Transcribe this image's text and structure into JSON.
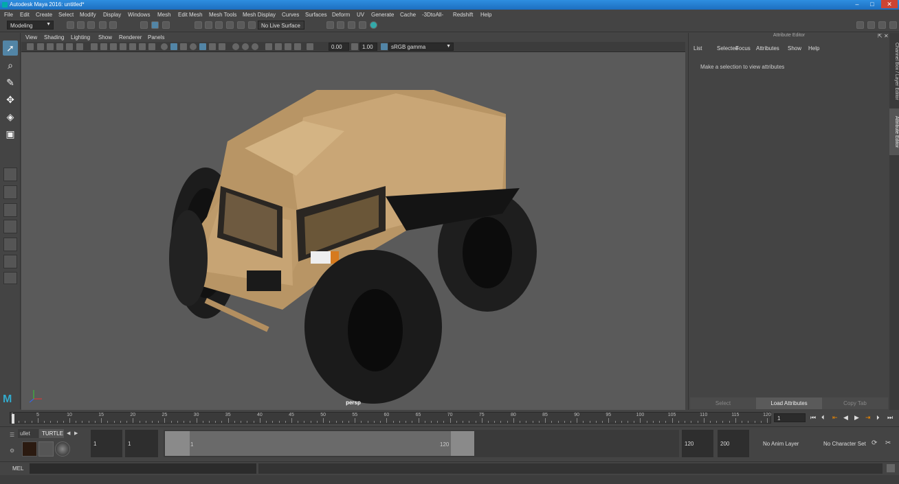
{
  "window": {
    "title": "Autodesk Maya 2016: untitled*",
    "min": "–",
    "max": "□",
    "close": "✕"
  },
  "menus": [
    "File",
    "Edit",
    "Create",
    "Select",
    "Modify",
    "Display",
    "Windows",
    "Mesh",
    "Edit Mesh",
    "Mesh Tools",
    "Mesh Display",
    "Curves",
    "Surfaces",
    "Deform",
    "UV",
    "Generate",
    "Cache",
    "-3DtoAll-",
    "Redshift",
    "Help"
  ],
  "shelf": {
    "mode": "Modeling",
    "live_surface": "No Live Surface"
  },
  "panel": {
    "menus": [
      "View",
      "Shading",
      "Lighting",
      "Show",
      "Renderer",
      "Panels"
    ],
    "exposure": "0.00",
    "gamma": "1.00",
    "color_space": "sRGB gamma",
    "camera_label": "persp"
  },
  "attribute_editor": {
    "header": "Attribute Editor",
    "menus": [
      "List",
      "Selected",
      "Focus",
      "Attributes",
      "Show",
      "Help"
    ],
    "message": "Make a selection to view attributes",
    "buttons": {
      "select": "Select",
      "load": "Load Attributes",
      "copy": "Copy Tab"
    }
  },
  "side_tabs": {
    "channel_box": "Channel Box / Layer Editor",
    "attribute_editor": "Attribute Editor"
  },
  "timeline": {
    "ticks": [
      "1",
      "5",
      "10",
      "15",
      "20",
      "25",
      "30",
      "35",
      "40",
      "45",
      "50",
      "55",
      "60",
      "65",
      "70",
      "75",
      "80",
      "85",
      "90",
      "95",
      "100",
      "105",
      "110",
      "115",
      "120"
    ],
    "current_frame": "1"
  },
  "range": {
    "shelf_tabs": [
      "ullet",
      "TURTLE"
    ],
    "start_frame": "1",
    "playback_start": "1",
    "range_start_label": "1",
    "range_end_label": "120",
    "playback_end": "120",
    "end_frame": "200",
    "anim_layer": "No Anim Layer",
    "character_set": "No Character Set"
  },
  "mel": {
    "label": "MEL"
  },
  "colors": {
    "accent": "#5285a6",
    "vehicle_body": "#c9a676",
    "tire": "#1a1a1a"
  }
}
